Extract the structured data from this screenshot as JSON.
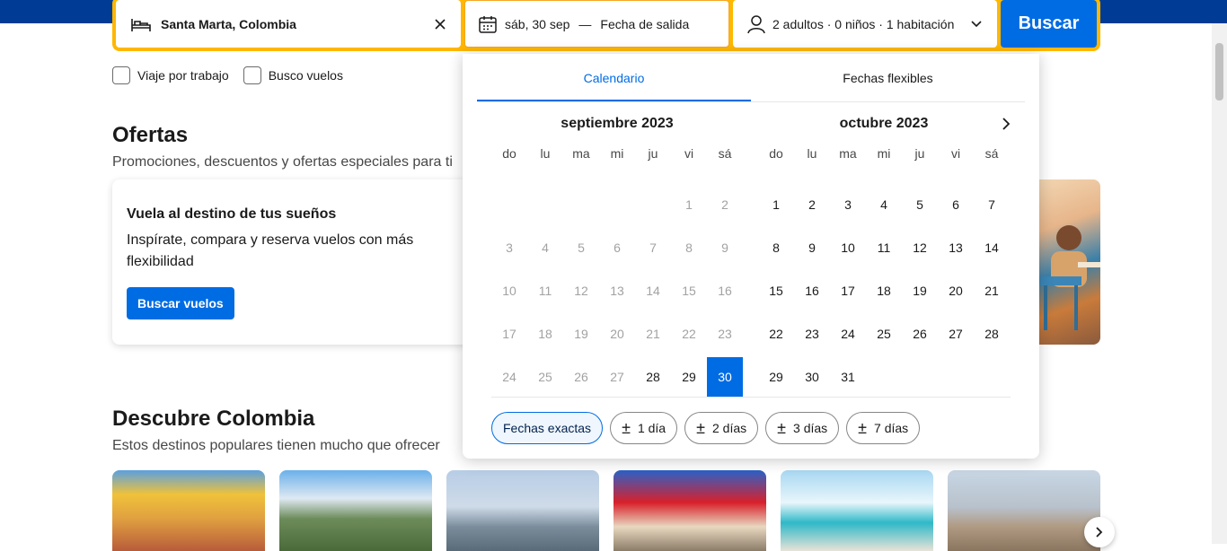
{
  "search": {
    "destination": "Santa Marta, Colombia",
    "check_in": "sáb, 30 sep",
    "separator": "—",
    "check_out_placeholder": "Fecha de salida",
    "guests": "2 adultos · 0 niños · 1 habitación",
    "button": "Buscar"
  },
  "options": {
    "work_trip": "Viaje por trabajo",
    "flights": "Busco vuelos"
  },
  "offers": {
    "title": "Ofertas",
    "subtitle": "Promociones, descuentos y ofertas especiales para ti",
    "card_title": "Vuela al destino de tus sueños",
    "card_desc": "Inspírate, compara y reserva vuelos con más flexibilidad",
    "card_button": "Buscar vuelos"
  },
  "discover": {
    "title": "Descubre Colombia",
    "subtitle": "Estos destinos populares tienen mucho que ofrecer"
  },
  "calendar": {
    "tabs": [
      "Calendario",
      "Fechas flexibles"
    ],
    "weekdays": [
      "do",
      "lu",
      "ma",
      "mi",
      "ju",
      "vi",
      "sá"
    ],
    "months": [
      {
        "title": "septiembre 2023",
        "weeks": [
          [
            "",
            "",
            "",
            "",
            "",
            "1",
            "2"
          ],
          [
            "3",
            "4",
            "5",
            "6",
            "7",
            "8",
            "9"
          ],
          [
            "10",
            "11",
            "12",
            "13",
            "14",
            "15",
            "16"
          ],
          [
            "17",
            "18",
            "19",
            "20",
            "21",
            "22",
            "23"
          ],
          [
            "24",
            "25",
            "26",
            "27",
            "28",
            "29",
            "30"
          ]
        ],
        "past_until": 27,
        "selected": "30"
      },
      {
        "title": "octubre 2023",
        "weeks": [
          [
            "1",
            "2",
            "3",
            "4",
            "5",
            "6",
            "7"
          ],
          [
            "8",
            "9",
            "10",
            "11",
            "12",
            "13",
            "14"
          ],
          [
            "15",
            "16",
            "17",
            "18",
            "19",
            "20",
            "21"
          ],
          [
            "22",
            "23",
            "24",
            "25",
            "26",
            "27",
            "28"
          ],
          [
            "29",
            "30",
            "31",
            "",
            "",
            "",
            ""
          ]
        ],
        "past_until": 0,
        "selected": ""
      }
    ],
    "chips": [
      "Fechas exactas",
      "1 día",
      "2 días",
      "3 días",
      "7 días"
    ],
    "chip_prefix": "±"
  },
  "colors": {
    "brand_dark": "#003b95",
    "accent": "#006ce4",
    "search_border": "#ffb700"
  }
}
